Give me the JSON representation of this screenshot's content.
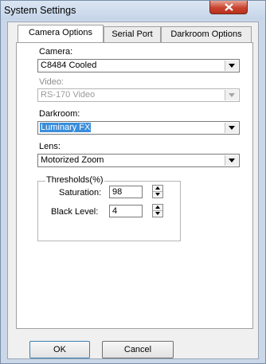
{
  "window": {
    "title": "System Settings"
  },
  "tabs": [
    {
      "label": "Camera Options"
    },
    {
      "label": "Serial Port"
    },
    {
      "label": "Darkroom Options"
    }
  ],
  "fields": {
    "camera": {
      "label": "Camera:",
      "value": "C8484 Cooled"
    },
    "video": {
      "label": "Video:",
      "value": "RS-170 Video"
    },
    "darkroom": {
      "label": "Darkroom:",
      "value": "Luminary FX"
    },
    "lens": {
      "label": "Lens:",
      "value": "Motorized Zoom"
    }
  },
  "thresholds": {
    "title": "Thresholds(%)",
    "saturation": {
      "label": "Saturation:",
      "value": "98"
    },
    "black_level": {
      "label": "Black Level:",
      "value": "4"
    }
  },
  "buttons": {
    "ok": "OK",
    "cancel": "Cancel"
  }
}
